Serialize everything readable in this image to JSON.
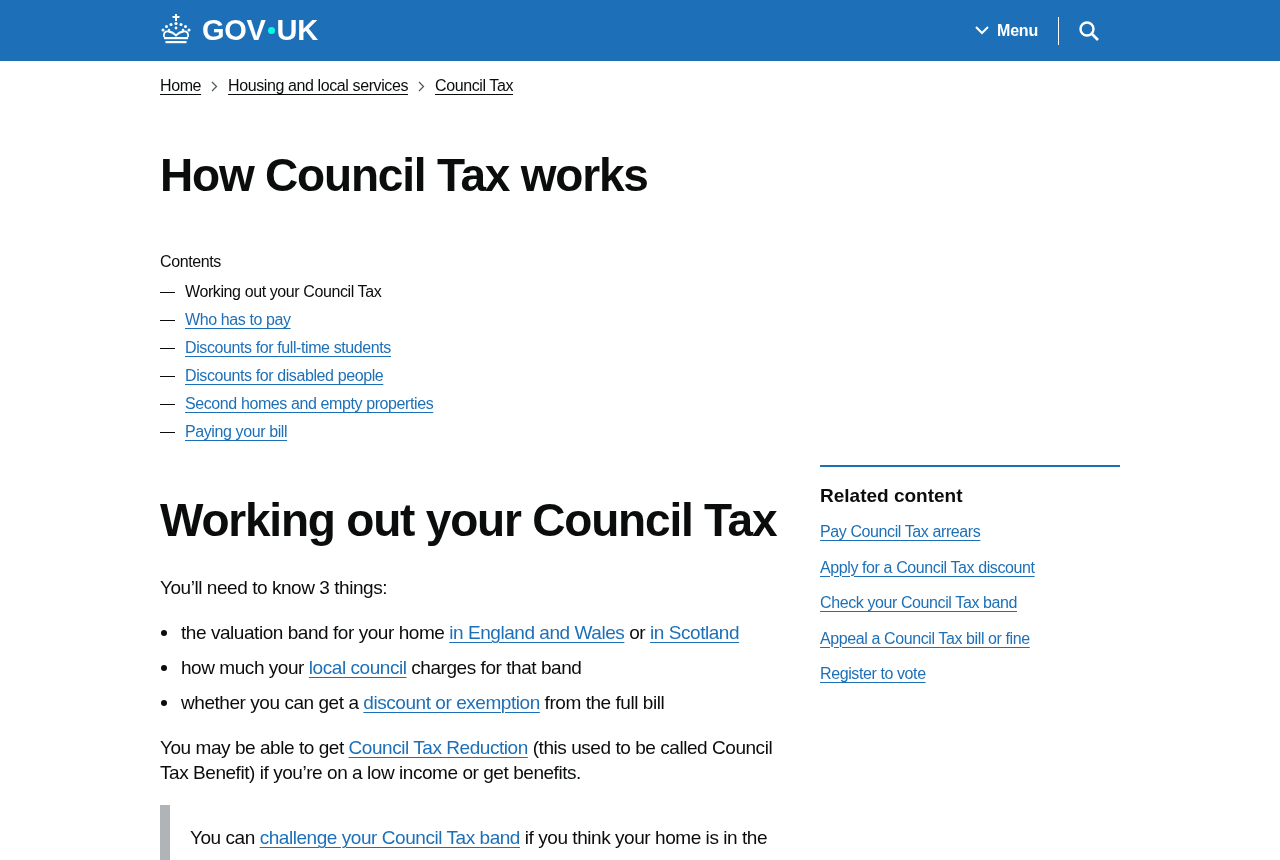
{
  "header": {
    "logo": {
      "before_dot": "GOV",
      "after_dot": "UK"
    },
    "menu_button": {
      "label": "Menu",
      "expanded": false
    }
  },
  "breadcrumbs": [
    "Home",
    "Housing and local services",
    "Council Tax"
  ],
  "title": "How Council Tax works",
  "contents": {
    "heading": "Contents",
    "items": [
      {
        "label": "Working out your Council Tax",
        "selected": true
      },
      {
        "label": "Who has to pay",
        "selected": false
      },
      {
        "label": "Discounts for full-time students",
        "selected": false
      },
      {
        "label": "Discounts for disabled people",
        "selected": false
      },
      {
        "label": "Second homes and empty properties",
        "selected": false
      },
      {
        "label": "Paying your bill",
        "selected": false
      }
    ]
  },
  "section": {
    "heading": "Working out your Council Tax",
    "intro": "You’ll need to know 3 things:",
    "bullets": [
      [
        {
          "kind": "text",
          "text": "the valuation band for your home "
        },
        {
          "kind": "link",
          "text": "in England and Wales"
        },
        {
          "kind": "text",
          "text": " or "
        },
        {
          "kind": "link",
          "text": "in Scotland"
        }
      ],
      [
        {
          "kind": "text",
          "text": "how much your "
        },
        {
          "kind": "link",
          "text": "local council"
        },
        {
          "kind": "text",
          "text": " charges for that band"
        }
      ],
      [
        {
          "kind": "text",
          "text": "whether you can get a "
        },
        {
          "kind": "link",
          "text": "discount or exemption"
        },
        {
          "kind": "text",
          "text": " from the full bill"
        }
      ]
    ],
    "paragraph": [
      {
        "kind": "text",
        "text": "You may be able to get "
      },
      {
        "kind": "link",
        "text": "Council Tax Reduction"
      },
      {
        "kind": "text",
        "text": " (this used to be called Council Tax Benefit) if you’re on a low income or get benefits."
      }
    ],
    "inset": [
      {
        "kind": "text",
        "text": "You can "
      },
      {
        "kind": "link",
        "text": "challenge your Council Tax band"
      },
      {
        "kind": "text",
        "text": " if you think your home is in the"
      }
    ]
  },
  "related": {
    "heading": "Related content",
    "links": [
      "Pay Council Tax arrears",
      "Apply for a Council Tax discount",
      "Check your Council Tax band",
      "Appeal a Council Tax bill or fine",
      "Register to vote"
    ]
  }
}
